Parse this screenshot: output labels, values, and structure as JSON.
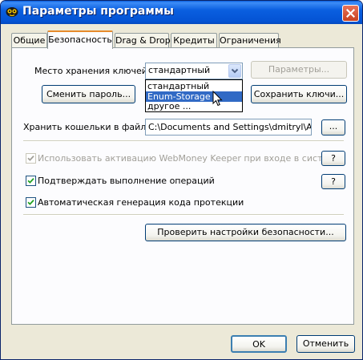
{
  "window": {
    "title": "Параметры программы",
    "icon": "webmoney-keeper-icon"
  },
  "tabs": [
    {
      "label": "Общие"
    },
    {
      "label": "Безопасность"
    },
    {
      "label": "Drag & Drop"
    },
    {
      "label": "Кредиты"
    },
    {
      "label": "Ограничения"
    }
  ],
  "active_tab": "Безопасность",
  "security": {
    "key_storage_label": "Место хранения ключей:",
    "key_storage_value": "стандартный",
    "key_storage_options": [
      "стандартный",
      "Enum-Storage",
      "другое ..."
    ],
    "key_storage_highlighted": "Enum-Storage",
    "params_button": "Параметры...",
    "change_password_button": "Сменить пароль...",
    "save_keys_button": "Сохранить ключи...",
    "wallet_file_label": "Хранить кошельки в файле:",
    "wallet_file_value": "C:\\Documents and Settings\\dmitryl\\Applica",
    "browse_button": "...",
    "options": [
      {
        "label": "Использовать активацию WebMoney Keeper при входе в систему",
        "checked": true,
        "enabled": false
      },
      {
        "label": "Подтверждать выполнение операций",
        "checked": true,
        "enabled": true
      },
      {
        "label": "Автоматическая генерация кода протекции",
        "checked": true,
        "enabled": true
      }
    ],
    "help_button": "?",
    "check_settings_button": "Проверить настройки безопасности..."
  },
  "footer": {
    "ok": "OK",
    "cancel": "Отменить"
  }
}
